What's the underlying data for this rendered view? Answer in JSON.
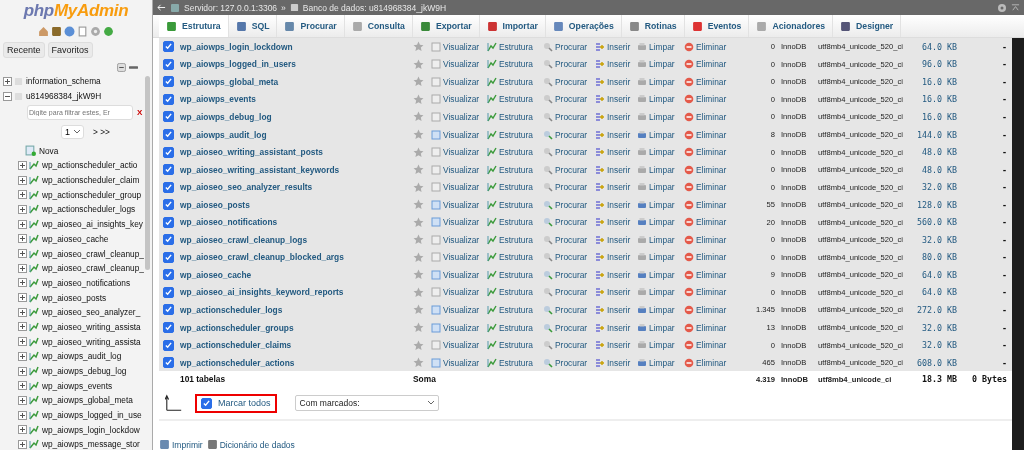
{
  "sidebar": {
    "logo": {
      "php": "php",
      "myadmin": "MyAdmin"
    },
    "tabs": [
      {
        "label": "Recente"
      },
      {
        "label": "Favoritos"
      }
    ],
    "databases": [
      {
        "name": "information_schema",
        "expanded": false
      },
      {
        "name": "u814968384_jkW9H",
        "expanded": true,
        "filter_placeholder": "Digite para filtrar estes, Er",
        "clear": "X",
        "page": "1",
        "next": "> >>",
        "new_item": "Nova",
        "tables": [
          "wp_actionscheduler_actio",
          "wp_actionscheduler_claim",
          "wp_actionscheduler_group",
          "wp_actionscheduler_logs",
          "wp_aioseo_ai_insights_key",
          "wp_aioseo_cache",
          "wp_aioseo_crawl_cleanup_",
          "wp_aioseo_crawl_cleanup_",
          "wp_aioseo_notifications",
          "wp_aioseo_posts",
          "wp_aioseo_seo_analyzer_",
          "wp_aioseo_writing_assista",
          "wp_aioseo_writing_assista",
          "wp_aiowps_audit_log",
          "wp_aiowps_debug_log",
          "wp_aiowps_events",
          "wp_aiowps_global_meta",
          "wp_aiowps_logged_in_use",
          "wp_aiowps_login_lockdow",
          "wp_aiowps_message_stor"
        ]
      }
    ]
  },
  "breadcrumb": {
    "server": "Servidor: 127.0.0.1:3306",
    "separator": "»",
    "database": "Banco de dados: u814968384_jkW9H"
  },
  "tabs": [
    {
      "label": "Estrutura",
      "selected": true
    },
    {
      "label": "SQL",
      "selected": false
    },
    {
      "label": "Procurar",
      "selected": false
    },
    {
      "label": "Consulta",
      "selected": false
    },
    {
      "label": "Exportar",
      "selected": false
    },
    {
      "label": "Importar",
      "selected": false
    },
    {
      "label": "Operações",
      "selected": false
    },
    {
      "label": "Rotinas",
      "selected": false
    },
    {
      "label": "Eventos",
      "selected": false
    },
    {
      "label": "Acionadores",
      "selected": false
    },
    {
      "label": "Designer",
      "selected": false
    }
  ],
  "table": {
    "rows": [
      {
        "name": "wp_aiowps_login_lockdown",
        "checked": true,
        "empty": true,
        "actions": [
          "Visualizar",
          "Estrutura",
          "Procurar",
          "Inserir",
          "Limpar",
          "Eliminar"
        ],
        "rows": "0",
        "engine": "InnoDB",
        "collation": "utf8mb4_unicode_520_ci",
        "size": "64.0 KB",
        "overhead": "-"
      },
      {
        "name": "wp_aiowps_logged_in_users",
        "checked": true,
        "empty": true,
        "actions": [
          "Visualizar",
          "Estrutura",
          "Procurar",
          "Inserir",
          "Limpar",
          "Eliminar"
        ],
        "rows": "0",
        "engine": "InnoDB",
        "collation": "utf8mb4_unicode_520_ci",
        "size": "96.0 KB",
        "overhead": "-"
      },
      {
        "name": "wp_aiowps_global_meta",
        "checked": true,
        "empty": true,
        "actions": [
          "Visualizar",
          "Estrutura",
          "Procurar",
          "Inserir",
          "Limpar",
          "Eliminar"
        ],
        "rows": "0",
        "engine": "InnoDB",
        "collation": "utf8mb4_unicode_520_ci",
        "size": "16.0 KB",
        "overhead": "-"
      },
      {
        "name": "wp_aiowps_events",
        "checked": true,
        "empty": true,
        "actions": [
          "Visualizar",
          "Estrutura",
          "Procurar",
          "Inserir",
          "Limpar",
          "Eliminar"
        ],
        "rows": "0",
        "engine": "InnoDB",
        "collation": "utf8mb4_unicode_520_ci",
        "size": "16.0 KB",
        "overhead": "-"
      },
      {
        "name": "wp_aiowps_debug_log",
        "checked": true,
        "empty": true,
        "actions": [
          "Visualizar",
          "Estrutura",
          "Procurar",
          "Inserir",
          "Limpar",
          "Eliminar"
        ],
        "rows": "0",
        "engine": "InnoDB",
        "collation": "utf8mb4_unicode_520_ci",
        "size": "16.0 KB",
        "overhead": "-"
      },
      {
        "name": "wp_aiowps_audit_log",
        "checked": true,
        "empty": false,
        "actions": [
          "Visualizar",
          "Estrutura",
          "Procurar",
          "Inserir",
          "Limpar",
          "Eliminar"
        ],
        "rows": "8",
        "engine": "InnoDB",
        "collation": "utf8mb4_unicode_520_ci",
        "size": "144.0 KB",
        "overhead": "-"
      },
      {
        "name": "wp_aioseo_writing_assistant_posts",
        "checked": true,
        "empty": true,
        "actions": [
          "Visualizar",
          "Estrutura",
          "Procurar",
          "Inserir",
          "Limpar",
          "Eliminar"
        ],
        "rows": "0",
        "engine": "InnoDB",
        "collation": "utf8mb4_unicode_520_ci",
        "size": "48.0 KB",
        "overhead": "-"
      },
      {
        "name": "wp_aioseo_writing_assistant_keywords",
        "checked": true,
        "empty": true,
        "actions": [
          "Visualizar",
          "Estrutura",
          "Procurar",
          "Inserir",
          "Limpar",
          "Eliminar"
        ],
        "rows": "0",
        "engine": "InnoDB",
        "collation": "utf8mb4_unicode_520_ci",
        "size": "48.0 KB",
        "overhead": "-"
      },
      {
        "name": "wp_aioseo_seo_analyzer_results",
        "checked": true,
        "empty": true,
        "actions": [
          "Visualizar",
          "Estrutura",
          "Procurar",
          "Inserir",
          "Limpar",
          "Eliminar"
        ],
        "rows": "0",
        "engine": "InnoDB",
        "collation": "utf8mb4_unicode_520_ci",
        "size": "32.0 KB",
        "overhead": "-"
      },
      {
        "name": "wp_aioseo_posts",
        "checked": true,
        "empty": false,
        "actions": [
          "Visualizar",
          "Estrutura",
          "Procurar",
          "Inserir",
          "Limpar",
          "Eliminar"
        ],
        "rows": "55",
        "engine": "InnoDB",
        "collation": "utf8mb4_unicode_520_ci",
        "size": "128.0 KB",
        "overhead": "-"
      },
      {
        "name": "wp_aioseo_notifications",
        "checked": true,
        "empty": false,
        "actions": [
          "Visualizar",
          "Estrutura",
          "Procurar",
          "Inserir",
          "Limpar",
          "Eliminar"
        ],
        "rows": "20",
        "engine": "InnoDB",
        "collation": "utf8mb4_unicode_520_ci",
        "size": "560.0 KB",
        "overhead": "-"
      },
      {
        "name": "wp_aioseo_crawl_cleanup_logs",
        "checked": true,
        "empty": true,
        "actions": [
          "Visualizar",
          "Estrutura",
          "Procurar",
          "Inserir",
          "Limpar",
          "Eliminar"
        ],
        "rows": "0",
        "engine": "InnoDB",
        "collation": "utf8mb4_unicode_520_ci",
        "size": "32.0 KB",
        "overhead": "-"
      },
      {
        "name": "wp_aioseo_crawl_cleanup_blocked_args",
        "checked": true,
        "empty": true,
        "actions": [
          "Visualizar",
          "Estrutura",
          "Procurar",
          "Inserir",
          "Limpar",
          "Eliminar"
        ],
        "rows": "0",
        "engine": "InnoDB",
        "collation": "utf8mb4_unicode_520_ci",
        "size": "80.0 KB",
        "overhead": "-"
      },
      {
        "name": "wp_aioseo_cache",
        "checked": true,
        "empty": false,
        "actions": [
          "Visualizar",
          "Estrutura",
          "Procurar",
          "Inserir",
          "Limpar",
          "Eliminar"
        ],
        "rows": "9",
        "engine": "InnoDB",
        "collation": "utf8mb4_unicode_520_ci",
        "size": "64.0 KB",
        "overhead": "-"
      },
      {
        "name": "wp_aioseo_ai_insights_keyword_reports",
        "checked": true,
        "empty": true,
        "actions": [
          "Visualizar",
          "Estrutura",
          "Procurar",
          "Inserir",
          "Limpar",
          "Eliminar"
        ],
        "rows": "0",
        "engine": "InnoDB",
        "collation": "utf8mb4_unicode_520_ci",
        "size": "64.0 KB",
        "overhead": "-"
      },
      {
        "name": "wp_actionscheduler_logs",
        "checked": true,
        "empty": false,
        "actions": [
          "Visualizar",
          "Estrutura",
          "Procurar",
          "Inserir",
          "Limpar",
          "Eliminar"
        ],
        "rows": "1.345",
        "engine": "InnoDB",
        "collation": "utf8mb4_unicode_520_ci",
        "size": "272.0 KB",
        "overhead": "-"
      },
      {
        "name": "wp_actionscheduler_groups",
        "checked": true,
        "empty": false,
        "actions": [
          "Visualizar",
          "Estrutura",
          "Procurar",
          "Inserir",
          "Limpar",
          "Eliminar"
        ],
        "rows": "13",
        "engine": "InnoDB",
        "collation": "utf8mb4_unicode_520_ci",
        "size": "32.0 KB",
        "overhead": "-"
      },
      {
        "name": "wp_actionscheduler_claims",
        "checked": true,
        "empty": true,
        "actions": [
          "Visualizar",
          "Estrutura",
          "Procurar",
          "Inserir",
          "Limpar",
          "Eliminar"
        ],
        "rows": "0",
        "engine": "InnoDB",
        "collation": "utf8mb4_unicode_520_ci",
        "size": "32.0 KB",
        "overhead": "-"
      },
      {
        "name": "wp_actionscheduler_actions",
        "checked": true,
        "empty": false,
        "actions": [
          "Visualizar",
          "Estrutura",
          "Procurar",
          "Inserir",
          "Limpar",
          "Eliminar"
        ],
        "rows": "465",
        "engine": "InnoDB",
        "collation": "utf8mb4_unicode_520_ci",
        "size": "608.0 KB",
        "overhead": "-"
      }
    ],
    "summary": {
      "count": "101 tabelas",
      "label": "Soma",
      "rows": "4.319",
      "engine": "InnoDB",
      "collation": "utf8mb4_unicode_ci",
      "size": "18.3 MB",
      "overhead": "0 Bytes"
    }
  },
  "bulk": {
    "check_all": {
      "label": "Marcar todos",
      "checked": true
    },
    "select": "Com marcados:"
  },
  "footer_links": [
    {
      "label": "Imprimir",
      "kind": "print"
    },
    {
      "label": "Dicionário de dados",
      "kind": "dictionary"
    }
  ]
}
